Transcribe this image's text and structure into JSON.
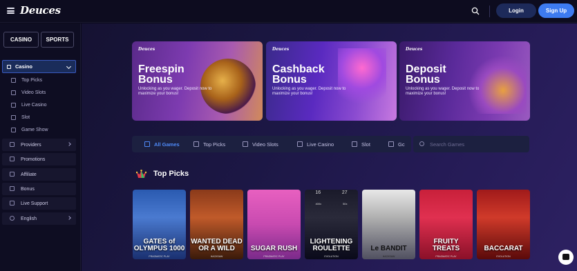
{
  "header": {
    "logo": "Deuces",
    "login_label": "Login",
    "signup_label": "Sign Up",
    "icons": [
      "menu-icon",
      "search-icon"
    ]
  },
  "sidebar": {
    "segments": [
      "CASINO",
      "SPORTS"
    ],
    "casino_section": {
      "label": "Casino",
      "items": [
        "Top Picks",
        "Video Slots",
        "Live Casino",
        "Slot",
        "Game Show"
      ]
    },
    "items": [
      "Providers",
      "Promotions",
      "Affiliate",
      "Bonus",
      "Live Support",
      "English"
    ]
  },
  "banners": [
    {
      "brand": "Deuces",
      "title": "Freespin Bonus",
      "desc": "Unlocking as you wager. Deposit now to maximize your bonus!"
    },
    {
      "brand": "Deuces",
      "title": "Cashback Bonus",
      "desc": "Unlocking as you wager. Deposit now to maximize your bonus!"
    },
    {
      "brand": "Deuces",
      "title": "Deposit Bonus",
      "desc": "Unlocking as you wager. Deposit now to maximize your bonus!"
    }
  ],
  "game_tabs": [
    "All Games",
    "Top Picks",
    "Video Slots",
    "Live Casino",
    "Slot",
    "Gc"
  ],
  "search": {
    "placeholder": "Search Games"
  },
  "section": {
    "title": "Top Picks"
  },
  "games": [
    {
      "title": "GATES of OLYMPUS 1000",
      "provider": "PRAGMATIC PLAY"
    },
    {
      "title": "WANTED DEAD OR A WILD",
      "provider": "HACKSAW"
    },
    {
      "title": "SUGAR RUSH",
      "provider": "PRAGMATIC PLAY"
    },
    {
      "title": "LIGHTENING ROULETTE",
      "provider": "EVOLUTION",
      "nums": [
        "16",
        "27"
      ],
      "tags": [
        "400x",
        "50x"
      ]
    },
    {
      "title": "Le BANDIT",
      "provider": "HACKSAW"
    },
    {
      "title": "FRUITY TREATS",
      "provider": "PRAGMATIC PLAY"
    },
    {
      "title": "BACCARAT",
      "provider": "EVOLUTION"
    }
  ],
  "colors": {
    "accent": "#3d7bf0",
    "bg": "#0b0a1c"
  }
}
